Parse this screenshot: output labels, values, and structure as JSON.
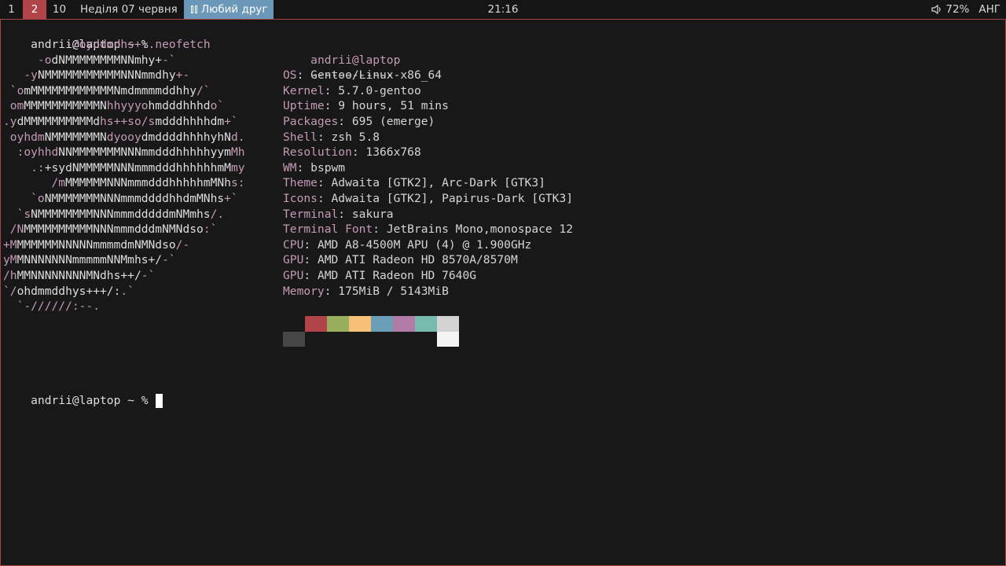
{
  "topbar": {
    "workspaces": [
      "1",
      "2",
      "10"
    ],
    "date": "Неділя 07 червня",
    "window_title": "Любий друг",
    "clock": "21:16",
    "volume": "72%",
    "layout": "АНГ"
  },
  "terminal": {
    "prompt_user": "andrii@laptop",
    "prompt_rest": " ~ % ",
    "command": "neofetch",
    "logo": [
      [
        [
          "pink",
          "         -/oyddmdhs+:."
        ]
      ],
      [
        [
          "pink",
          "     -o"
        ],
        [
          "white",
          "dNMMMMMMMMNNmhy+"
        ],
        [
          "pink",
          "-`"
        ]
      ],
      [
        [
          "pink",
          "   -y"
        ],
        [
          "white",
          "NMMMMMMMMMMMNNNmmdhy"
        ],
        [
          "pink",
          "+-"
        ]
      ],
      [
        [
          "pink",
          " `o"
        ],
        [
          "white",
          "mMMMMMMMMMMMMNmdmmmmddhhy"
        ],
        [
          "pink",
          "/`"
        ]
      ],
      [
        [
          "pink",
          " om"
        ],
        [
          "white",
          "MMMMMMMMMMMN"
        ],
        [
          "pink",
          "hhyyyo"
        ],
        [
          "white",
          "hmdddhhhd"
        ],
        [
          "pink",
          "o`"
        ]
      ],
      [
        [
          "pink",
          ".y"
        ],
        [
          "white",
          "dMMMMMMMMMMd"
        ],
        [
          "pink",
          "hs++so/s"
        ],
        [
          "white",
          "mdddhhhhdm"
        ],
        [
          "pink",
          "+`"
        ]
      ],
      [
        [
          "pink",
          " oyhdm"
        ],
        [
          "white",
          "NMMMMMMMN"
        ],
        [
          "pink",
          "dyooy"
        ],
        [
          "white",
          "dmddddhhhhyhN"
        ],
        [
          "pink",
          "d."
        ]
      ],
      [
        [
          "pink",
          "  :oyhhd"
        ],
        [
          "white",
          "NNMMMMMMMNNNmmdddhhhhhyym"
        ],
        [
          "pink",
          "Mh"
        ]
      ],
      [
        [
          "pink",
          "    .:"
        ],
        [
          "white",
          "+sydNMMMMMNNNmmmdddhhhhhhmM"
        ],
        [
          "pink",
          "my"
        ]
      ],
      [
        [
          "pink",
          "       /m"
        ],
        [
          "white",
          "MMMMMMNNNmmmdddhhhhhmMNh"
        ],
        [
          "pink",
          "s:"
        ]
      ],
      [
        [
          "pink",
          "    `o"
        ],
        [
          "white",
          "NMMMMMMMNNNmmmddddhhdmMNhs"
        ],
        [
          "pink",
          "+`"
        ]
      ],
      [
        [
          "pink",
          "  `s"
        ],
        [
          "white",
          "NMMMMMMMMNNNmmmdddddmNMmhs"
        ],
        [
          "pink",
          "/."
        ]
      ],
      [
        [
          "pink",
          " /N"
        ],
        [
          "white",
          "MMMMMMMMMMNNNmmmdddmNMNdso"
        ],
        [
          "pink",
          ":`"
        ]
      ],
      [
        [
          "pink",
          "+M"
        ],
        [
          "white",
          "MMMMMMNNNNNmmmmdmNMNdso"
        ],
        [
          "pink",
          "/-"
        ]
      ],
      [
        [
          "pink",
          "yM"
        ],
        [
          "white",
          "MNNNNNNNmmmmmNNMmhs+/"
        ],
        [
          "pink",
          "-`"
        ]
      ],
      [
        [
          "pink",
          "/h"
        ],
        [
          "white",
          "MMNNNNNNNNMNdhs++/"
        ],
        [
          "pink",
          "-`"
        ]
      ],
      [
        [
          "pink",
          "`/"
        ],
        [
          "white",
          "ohdmmddhys+++/:"
        ],
        [
          "pink",
          ".`"
        ]
      ],
      [
        [
          "pink",
          "  `-//////:--."
        ]
      ]
    ],
    "info_header": "andrii@laptop",
    "separator": "-------------",
    "info": [
      {
        "key": "OS",
        "value": "Gentoo/Linux x86_64"
      },
      {
        "key": "Kernel",
        "value": "5.7.0-gentoo"
      },
      {
        "key": "Uptime",
        "value": "9 hours, 51 mins"
      },
      {
        "key": "Packages",
        "value": "695 (emerge)"
      },
      {
        "key": "Shell",
        "value": "zsh 5.8"
      },
      {
        "key": "Resolution",
        "value": "1366x768"
      },
      {
        "key": "WM",
        "value": "bspwm"
      },
      {
        "key": "Theme",
        "value": "Adwaita [GTK2], Arc-Dark [GTK3]"
      },
      {
        "key": "Icons",
        "value": "Adwaita [GTK2], Papirus-Dark [GTK3]"
      },
      {
        "key": "Terminal",
        "value": "sakura"
      },
      {
        "key": "Terminal Font",
        "value": "JetBrains Mono,monospace 12"
      },
      {
        "key": "CPU",
        "value": "AMD A8-4500M APU (4) @ 1.900GHz"
      },
      {
        "key": "GPU",
        "value": "AMD ATI Radeon HD 8570A/8570M"
      },
      {
        "key": "GPU",
        "value": "AMD ATI Radeon HD 7640G"
      },
      {
        "key": "Memory",
        "value": "175MiB / 5143MiB"
      }
    ],
    "palette_top": [
      "#181818",
      "#b04448",
      "#99ad5e",
      "#f7c078",
      "#6d9eb8",
      "#b07ba6",
      "#76bbae",
      "#d3d3d3"
    ],
    "palette_bottom": [
      "#474747",
      "#181818",
      "#181818",
      "#181818",
      "#181818",
      "#181818",
      "#181818",
      "#f4f4f4"
    ],
    "colors": {
      "accent": "#b04448",
      "window_title_bg": "#6b98b8",
      "key": "#c49ab5"
    }
  }
}
